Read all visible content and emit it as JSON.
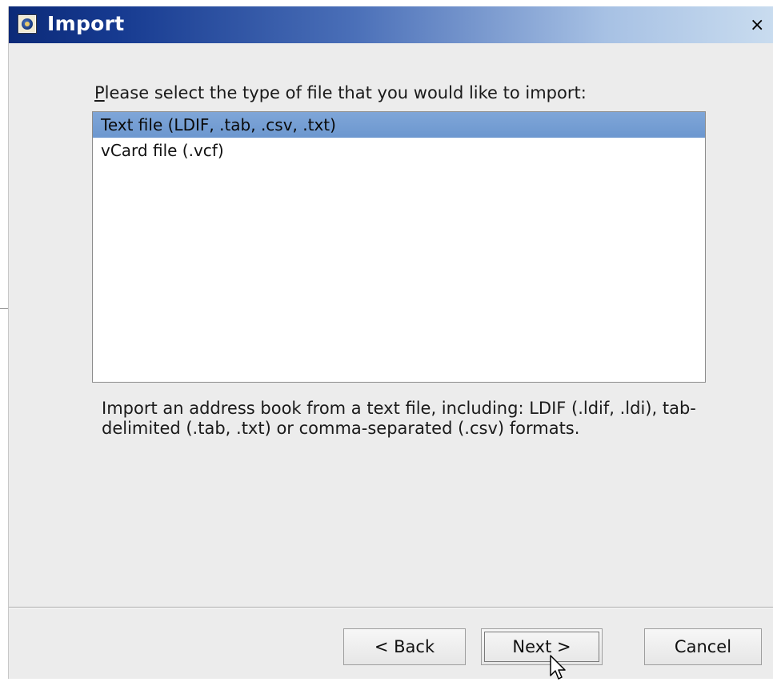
{
  "window": {
    "title": "Import",
    "close_glyph": "×"
  },
  "prompt": {
    "mnemonic": "P",
    "text": "lease select the type of file that you would like to import:"
  },
  "file_types": [
    {
      "label": "Text file (LDIF, .tab, .csv, .txt)",
      "selected": true
    },
    {
      "label": "vCard file (.vcf)",
      "selected": false
    }
  ],
  "description": "Import an address book from a text file, including: LDIF (.ldif, .ldi), tab-delimited (.tab, .txt) or comma-separated (.csv) formats.",
  "buttons": {
    "back": "< Back",
    "next": "Next >",
    "cancel": "Cancel"
  },
  "colors": {
    "titlebar_start": "#0c2a78",
    "titlebar_end": "#c9dcef",
    "selection": "#7fa6d8",
    "dialog_bg": "#ececec"
  },
  "icons": {
    "title": "addressbook-app-icon",
    "close": "close-icon",
    "cursor": "mouse-pointer-icon"
  }
}
